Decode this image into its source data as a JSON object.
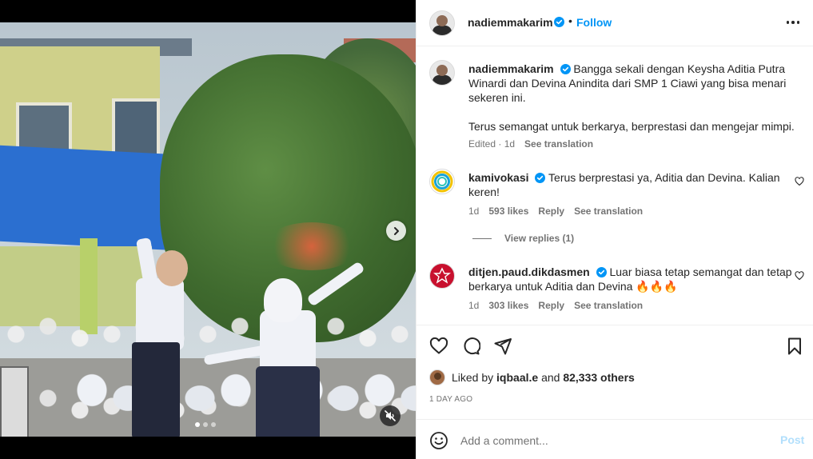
{
  "post": {
    "author": "nadiemmakarim",
    "follow_label": "Follow",
    "separator": "•"
  },
  "media": {
    "slide_count": 3,
    "active_slide": 1
  },
  "caption": {
    "username": "nadiemmakarim",
    "text": "Bangga sekali dengan Keysha Aditia Putra Winardi dan Devina Anindita dari SMP 1 Ciawi yang bisa menari sekeren ini.",
    "text2": "Terus semangat untuk berkarya, berprestasi dan mengejar mimpi.",
    "edited": "Edited · 1d",
    "see_translation": "See translation"
  },
  "comments": [
    {
      "username": "kamivokasi",
      "text": "Terus berprestasi ya, Aditia dan Devina. Kalian keren!",
      "time": "1d",
      "likes": "593 likes",
      "reply": "Reply",
      "see_translation": "See translation",
      "view_replies": "View replies (1)"
    },
    {
      "username": "ditjen.paud.dikdasmen",
      "text": "Luar biasa tetap semangat dan tetap berkarya untuk Aditia dan Devina 🔥🔥🔥",
      "time": "1d",
      "likes": "303 likes",
      "reply": "Reply",
      "see_translation": "See translation"
    }
  ],
  "likes_line": {
    "prefix": "Liked by",
    "user": "iqbaal.e",
    "middle": "and",
    "others": "82,333 others"
  },
  "timestamp": "1 DAY AGO",
  "add_comment": {
    "placeholder": "Add a comment...",
    "post_label": "Post"
  },
  "colors": {
    "accent": "#0095f6",
    "post_disabled": "#b2dffc",
    "verified": "#0095f6",
    "muted_text": "#737373"
  }
}
